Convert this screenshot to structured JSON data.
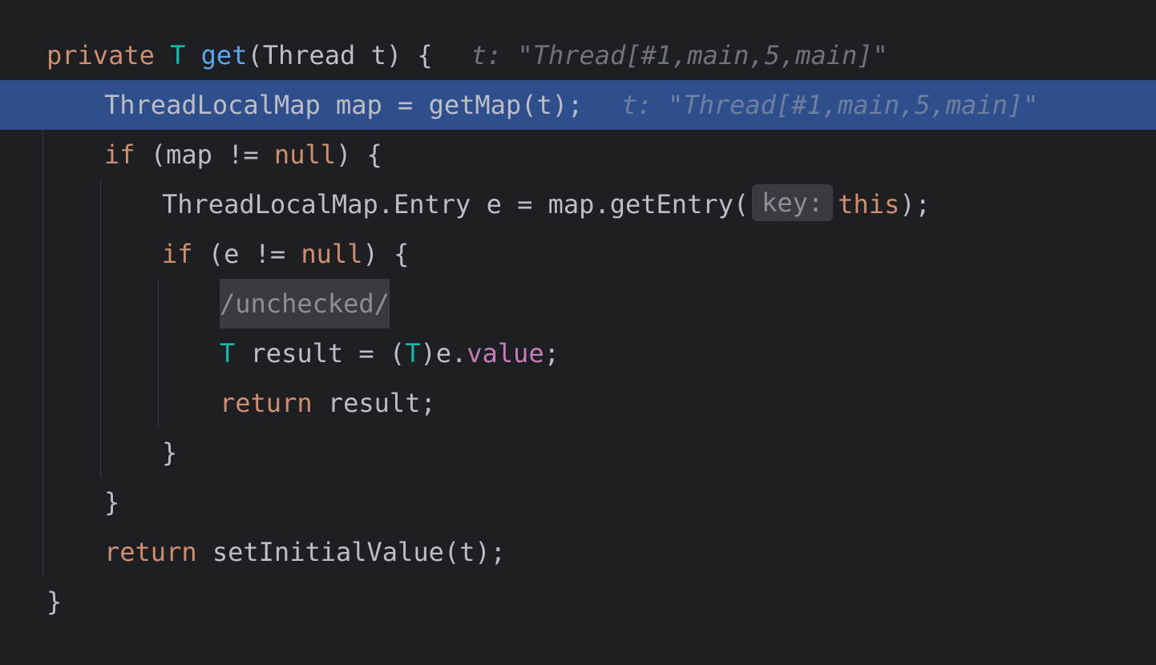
{
  "editor": {
    "language": "java",
    "colors": {
      "background": "#1e1f22",
      "current_line": "#2e4e8c",
      "keyword": "#cf8e6d",
      "type_param": "#16baac",
      "method_decl": "#56a8f5",
      "field": "#c77dbb",
      "text": "#bcbec4",
      "inlay_hint": "#6f737a"
    },
    "lines": {
      "l1": {
        "kw_private": "private",
        "type_T": "T",
        "method_name": "get",
        "signature": "(Thread t) {",
        "debug_hint": "t: \"Thread[#1,main,5,main]\""
      },
      "l2": {
        "code": "ThreadLocalMap map = getMap(t);",
        "debug_hint": "t: \"Thread[#1,main,5,main]\""
      },
      "l3": {
        "kw_if": "if",
        "cond_open": " (map != ",
        "kw_null": "null",
        "cond_close": ") {"
      },
      "l4": {
        "code_pre": "ThreadLocalMap.Entry e = map.getEntry(",
        "param_hint": "key:",
        "kw_this": "this",
        "code_post": ");"
      },
      "l5": {
        "kw_if": "if",
        "cond_open": " (e != ",
        "kw_null": "null",
        "cond_close": ") {"
      },
      "l6": {
        "folded_comment": "/unchecked/"
      },
      "l7": {
        "type_T": "T",
        "mid": " result = (",
        "type_T2": "T",
        "after_cast": ")e.",
        "field_value": "value",
        "end": ";"
      },
      "l8": {
        "kw_return": "return",
        "rest": " result;"
      },
      "l9": {
        "brace": "}"
      },
      "l10": {
        "brace": "}"
      },
      "l11": {
        "kw_return": "return",
        "rest": " setInitialValue(t);"
      },
      "l12": {
        "brace": "}"
      }
    }
  }
}
